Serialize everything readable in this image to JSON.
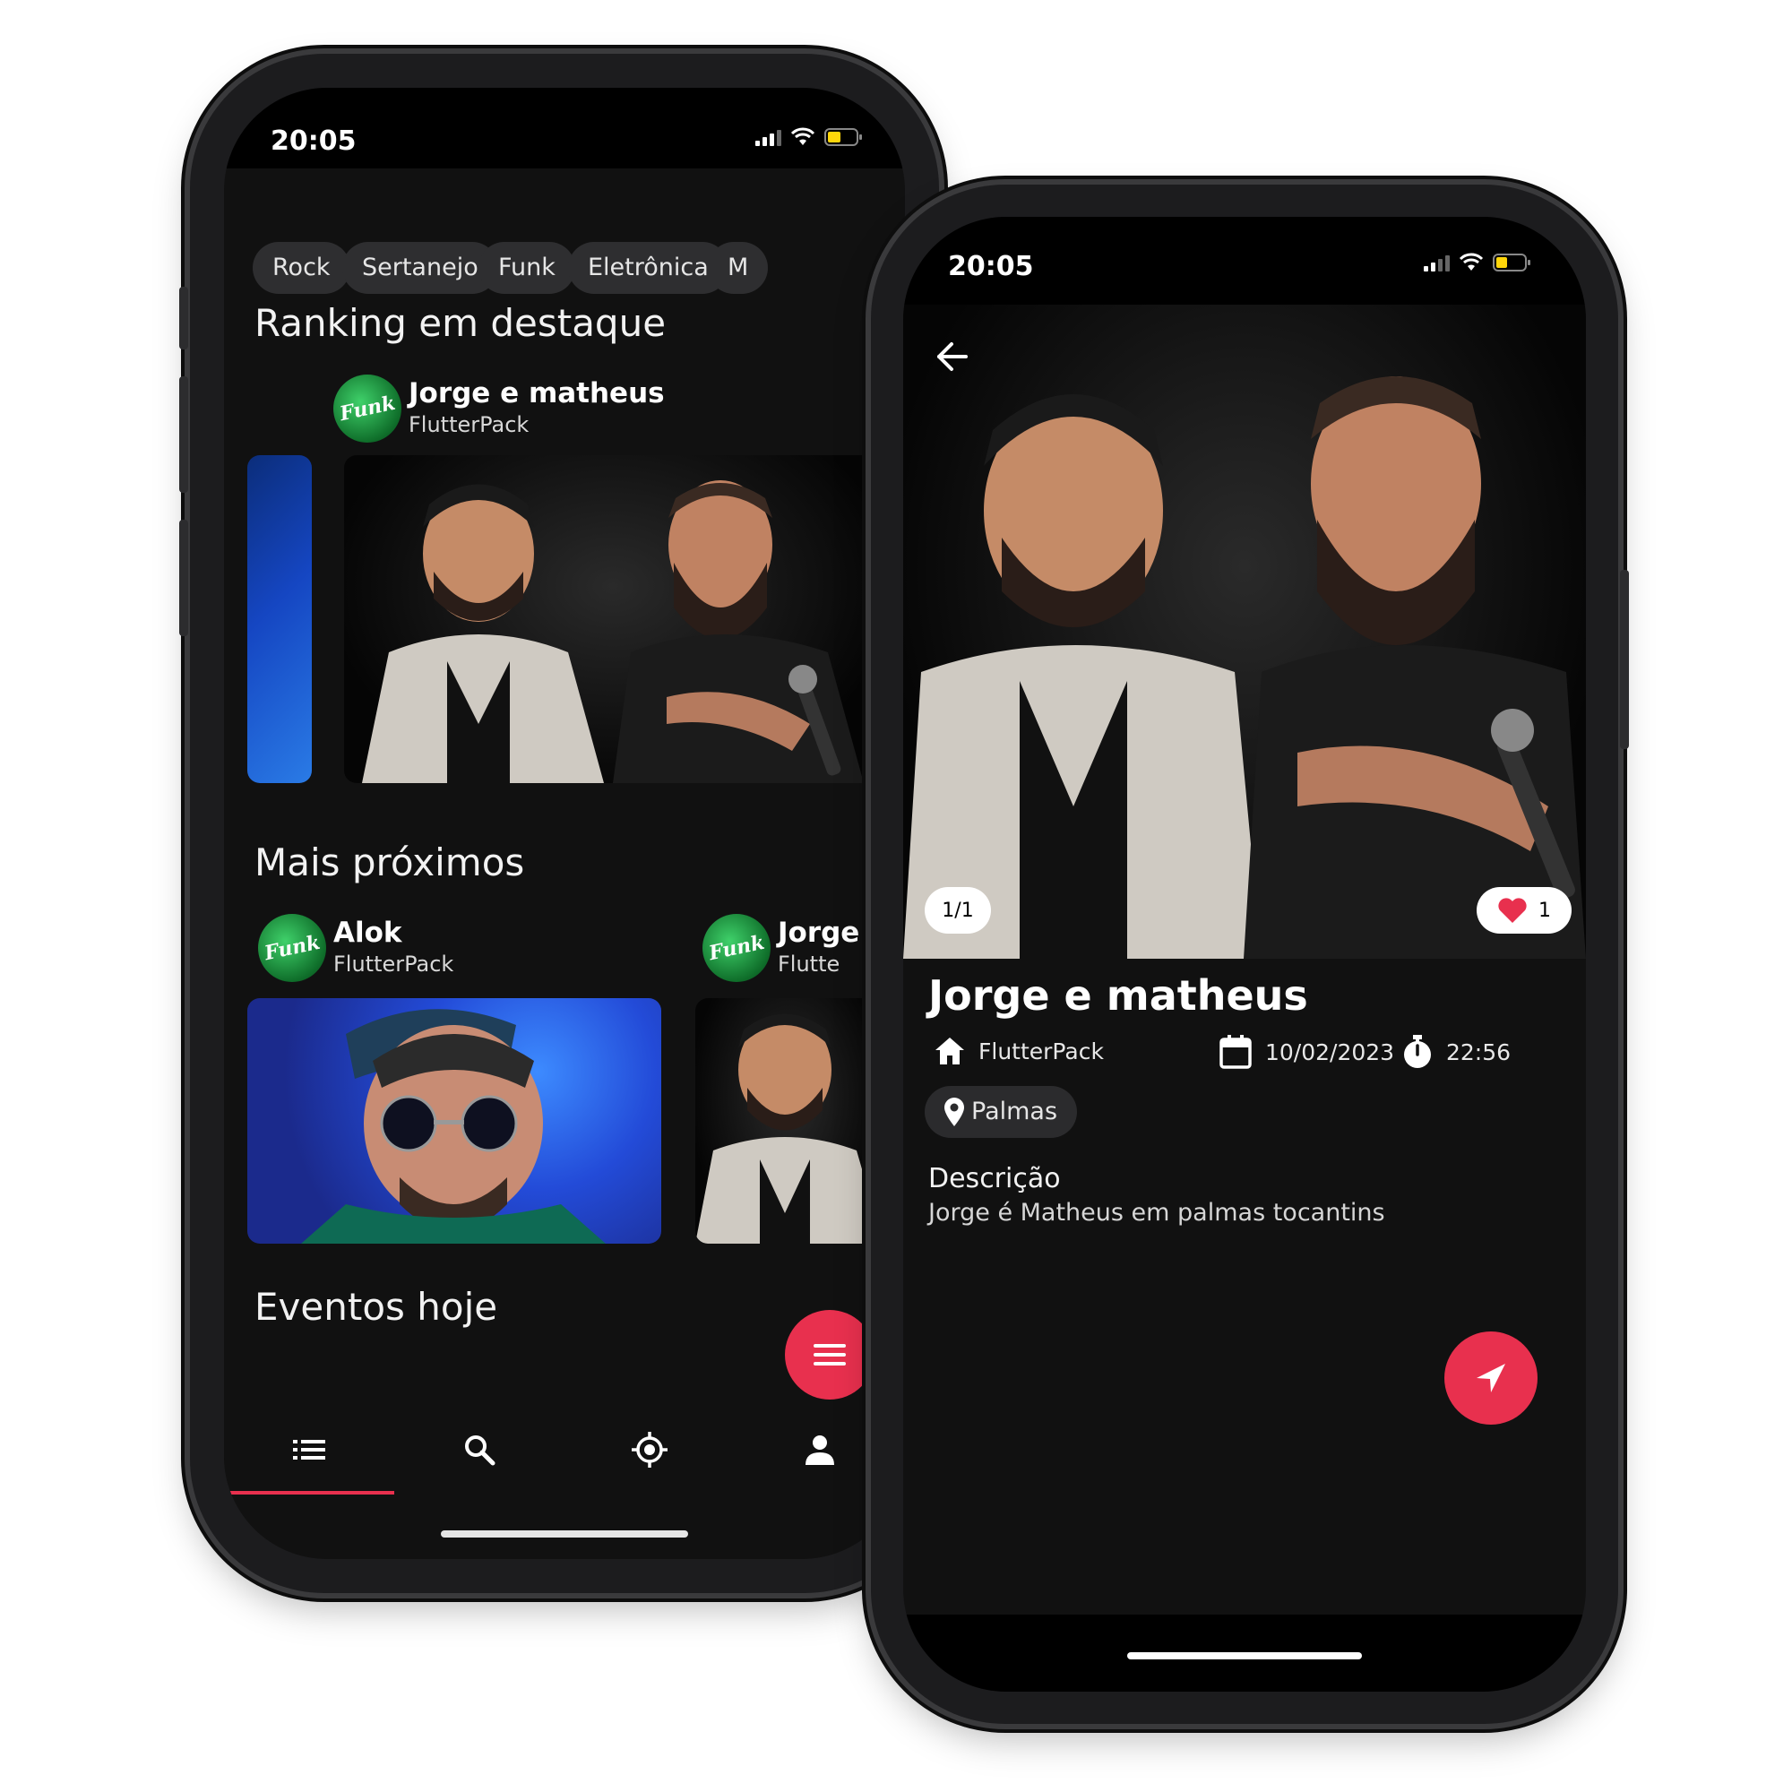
{
  "phone_left": {
    "status": {
      "time": "20:05"
    },
    "categories": [
      "Rock",
      "Sertanejo",
      "Funk",
      "Eletrônica",
      "M"
    ],
    "ranking": {
      "title": "Ranking em destaque",
      "card": {
        "name": "Jorge e matheus",
        "subtitle": "FlutterPack"
      }
    },
    "nearby": {
      "title": "Mais próximos",
      "cards": [
        {
          "name": "Alok",
          "subtitle": "FlutterPack"
        },
        {
          "name": "Jorge",
          "subtitle": "Flutte"
        }
      ]
    },
    "today": {
      "title": "Eventos hoje"
    },
    "bottom_nav": [
      "list-icon",
      "search-icon",
      "location-target-icon",
      "person-icon"
    ]
  },
  "phone_right": {
    "status": {
      "time": "20:05"
    },
    "image_counter": "1/1",
    "likes": "1",
    "title": "Jorge e matheus",
    "venue": "FlutterPack",
    "date": "10/02/2023",
    "time": "22:56",
    "city": "Palmas",
    "description_title": "Descrição",
    "description_text": "Jorge é Matheus em palmas tocantins"
  },
  "colors": {
    "accent": "#e8304e",
    "background": "#111111",
    "chip": "#2e2e30"
  },
  "avatar_logo_text": "Funk"
}
